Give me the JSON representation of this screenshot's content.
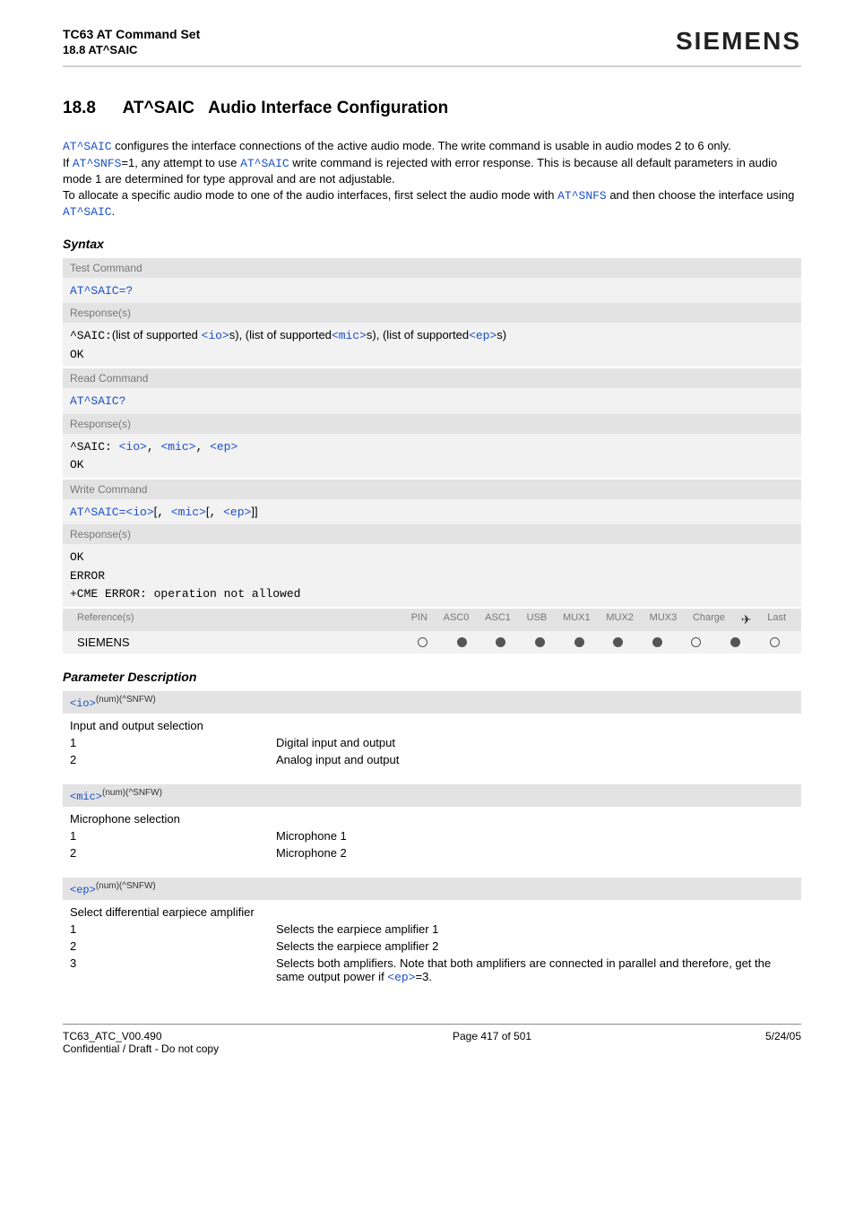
{
  "header": {
    "doc_title": "TC63 AT Command Set",
    "doc_section": "18.8 AT^SAIC",
    "brand": "SIEMENS"
  },
  "section": {
    "number": "18.8",
    "cmd": "AT^SAIC",
    "title": "Audio Interface Configuration"
  },
  "intro": {
    "cmd1": "AT^SAIC",
    "t1": " configures the interface connections of the active audio mode. The write command is usable in audio modes 2 to 6 only.",
    "cmd2a": "AT^SNFS",
    "t2a": "If ",
    "t2b": "=1, any attempt to use ",
    "cmd2b": "AT^SAIC",
    "t2c": " write command is rejected with error response. This is because all default parameters in audio mode 1 are determined for type approval and are not adjustable.",
    "t3a": "To allocate a specific audio mode to one of the audio interfaces, first select the audio mode with ",
    "cmd3a": "AT^SNFS",
    "t3b": " and then choose the interface using ",
    "cmd3b": "AT^SAIC",
    "t3c": "."
  },
  "syntax_label": "Syntax",
  "syntax": {
    "test_label": "Test Command",
    "test_cmd": "AT^SAIC=?",
    "resp_label": "Response(s)",
    "test_resp_prefix": "^SAIC:",
    "test_resp_mid1": "(list of supported ",
    "io": "<io>",
    "test_resp_mid2": "s), (list of supported",
    "mic": "<mic>",
    "test_resp_mid3": "s), (list of supported",
    "ep": "<ep>",
    "test_resp_mid4": "s)",
    "ok": "OK",
    "read_label": "Read Command",
    "read_cmd": "AT^SAIC?",
    "read_resp_prefix": "^SAIC: ",
    "comma": ", ",
    "write_label": "Write Command",
    "write_cmd_prefix": "AT^SAIC=",
    "lbracket": "[",
    "rbracket": "]",
    "error": "ERROR",
    "cme": "+CME ERROR: operation not allowed",
    "ref_label": "Reference(s)",
    "ref_val": "SIEMENS",
    "cols": [
      "PIN",
      "ASC0",
      "ASC1",
      "USB",
      "MUX1",
      "MUX2",
      "MUX3",
      "Charge",
      "✈",
      "Last"
    ],
    "dots": [
      "hollow",
      "filled",
      "filled",
      "filled",
      "filled",
      "filled",
      "filled",
      "hollow",
      "filled",
      "hollow"
    ]
  },
  "param_label": "Parameter Description",
  "params": {
    "io": {
      "tag": "<io>",
      "sup": "(num)(^SNFW)",
      "desc": "Input and output selection",
      "rows": [
        {
          "k": "1",
          "v": "Digital input and output"
        },
        {
          "k": "2",
          "v": "Analog input and output"
        }
      ]
    },
    "mic": {
      "tag": "<mic>",
      "sup": "(num)(^SNFW)",
      "desc": "Microphone selection",
      "rows": [
        {
          "k": "1",
          "v": "Microphone 1"
        },
        {
          "k": "2",
          "v": "Microphone 2"
        }
      ]
    },
    "ep": {
      "tag": "<ep>",
      "sup": "(num)(^SNFW)",
      "desc": "Select differential earpiece amplifier",
      "rows": [
        {
          "k": "1",
          "v": "Selects the earpiece amplifier 1"
        },
        {
          "k": "2",
          "v": "Selects the earpiece amplifier 2"
        }
      ],
      "row3_k": "3",
      "row3_v_a": "Selects both amplifiers. Note that both amplifiers are connected in parallel and therefore, get the same output power if ",
      "row3_ep": "<ep>",
      "row3_v_b": "=3."
    }
  },
  "footer": {
    "version": "TC63_ATC_V00.490",
    "conf": "Confidential / Draft - Do not copy",
    "page": "Page 417 of 501",
    "date": "5/24/05"
  }
}
